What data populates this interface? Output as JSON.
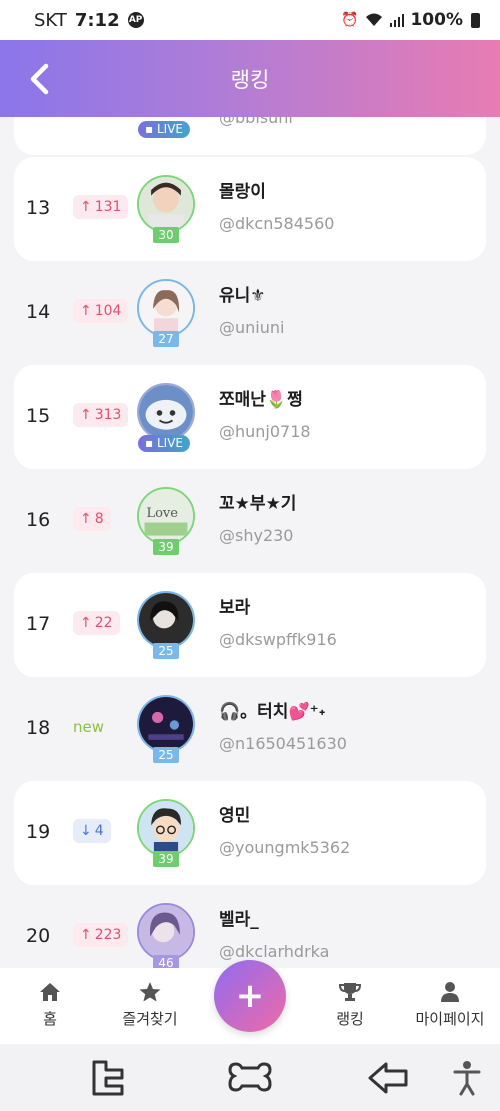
{
  "status_bar": {
    "carrier": "SKT",
    "time": "7:12",
    "badge": "AP",
    "battery": "100%"
  },
  "header": {
    "title": "랭킹"
  },
  "rows": [
    {
      "rank": "13",
      "change_dir": "up",
      "change": "131",
      "name": "몰랑이",
      "handle": "@dkcn584560",
      "level": "30",
      "live": false,
      "card": true
    },
    {
      "rank": "14",
      "change_dir": "up",
      "change": "104",
      "name": "유니⚜",
      "handle": "@uniuni",
      "level": "27",
      "live": false,
      "card": false
    },
    {
      "rank": "15",
      "change_dir": "up",
      "change": "313",
      "name": "쪼매난🌷쩡",
      "handle": "@hunj0718",
      "level": "",
      "live": true,
      "card": true
    },
    {
      "rank": "16",
      "change_dir": "up",
      "change": "8",
      "name": "꼬★부★기",
      "handle": "@shy230",
      "level": "39",
      "live": false,
      "card": false
    },
    {
      "rank": "17",
      "change_dir": "up",
      "change": "22",
      "name": "보라",
      "handle": "@dkswpffk916",
      "level": "25",
      "live": false,
      "card": true
    },
    {
      "rank": "18",
      "change_dir": "new",
      "change": "new",
      "name": "🎧。터치💕⁺˖",
      "handle": "@n1650451630",
      "level": "25",
      "live": false,
      "card": false
    },
    {
      "rank": "19",
      "change_dir": "down",
      "change": "4",
      "name": "영민",
      "handle": "@youngmk5362",
      "level": "39",
      "live": false,
      "card": true
    },
    {
      "rank": "20",
      "change_dir": "up",
      "change": "223",
      "name": "벨라_",
      "handle": "@dkclarhdrka",
      "level": "46",
      "live": false,
      "card": false
    }
  ],
  "partial_top": {
    "live_label": "LIVE",
    "handle": "@bbisuni"
  },
  "nav": {
    "home": "홈",
    "favorites": "즐겨찾기",
    "add": "+",
    "ranking": "랭킹",
    "mypage": "마이페이지"
  },
  "colors": {
    "header_start": "#8a76ea",
    "header_end": "#e87cb3",
    "up": "#e0506f",
    "down": "#4b74d8",
    "new": "#8cc13f"
  }
}
